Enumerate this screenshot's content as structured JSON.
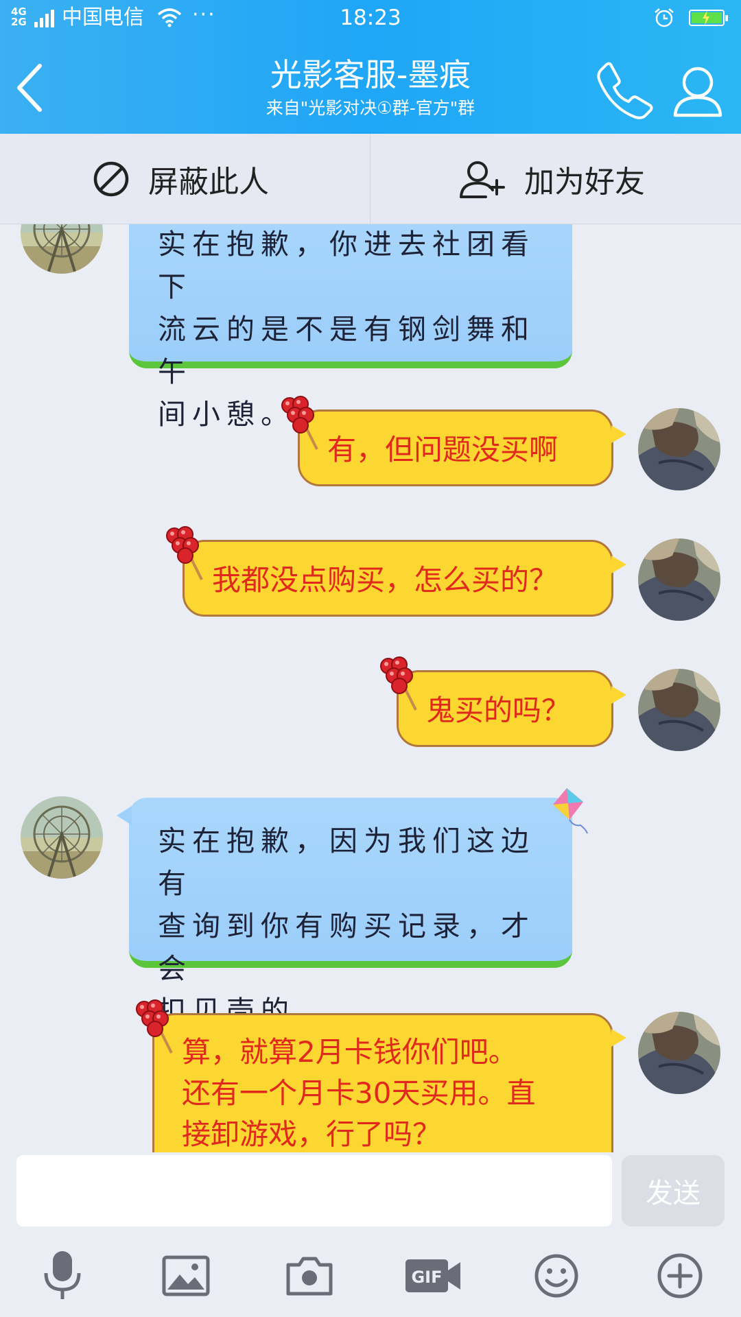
{
  "status_bar": {
    "network_line1": "4G",
    "network_line2": "2G",
    "carrier": "中国电信",
    "time": "18:23",
    "icons": [
      "signal-icon",
      "wifi-icon",
      "more-dots-icon",
      "alarm-icon",
      "battery-charging-icon"
    ]
  },
  "header": {
    "title": "光影客服-墨痕",
    "subtitle": "来自\"光影对决①群-官方\"群",
    "icons": [
      "back-arrow-icon",
      "phone-icon",
      "profile-icon"
    ]
  },
  "actions": {
    "block_label": "屏蔽此人",
    "add_friend_label": "加为好友",
    "icons": [
      "block-icon",
      "add-friend-icon"
    ]
  },
  "messages": [
    {
      "sender": "other",
      "text": "实在抱歉，你进去社团看下流云的是不是有钢剑舞和午间小憩。"
    },
    {
      "sender": "self",
      "text": "有，但问题没买啊"
    },
    {
      "sender": "self",
      "text": "我都没点购买，怎么买的？"
    },
    {
      "sender": "self",
      "text": "鬼买的吗？"
    },
    {
      "sender": "other",
      "text": "实在抱歉，因为我们这边有查询到你有购买记录，才会扣贝壳的。"
    },
    {
      "sender": "self",
      "text": "算，就算2月卡钱你们吧。还有一个月卡30天买用。直接卸游戏，行了吗？"
    }
  ],
  "messages_display": {
    "m0_l1": "实在抱歉，你进去社团看下",
    "m0_l2": "流云的是不是有钢剑舞和午",
    "m0_l3": "间小憩。",
    "m4_l1": "实在抱歉，因为我们这边有",
    "m4_l2": "查询到你有购买记录，才会",
    "m4_l3": "扣贝壳的。",
    "m5_l1": "算，就算2月卡钱你们吧。",
    "m5_l2": "还有一个月卡30天买用。直",
    "m5_l3": "接卸游戏，行了吗？"
  },
  "input": {
    "value": "",
    "send_label": "发送"
  },
  "toolbar": {
    "icons": [
      "microphone-icon",
      "image-icon",
      "camera-icon",
      "gif-icon",
      "emoji-icon",
      "plus-icon"
    ]
  },
  "colors": {
    "header_blue": "#1fa6f6",
    "other_bubble": "#9ccefb",
    "self_bubble": "#fcd731",
    "self_text": "#e0291c"
  }
}
